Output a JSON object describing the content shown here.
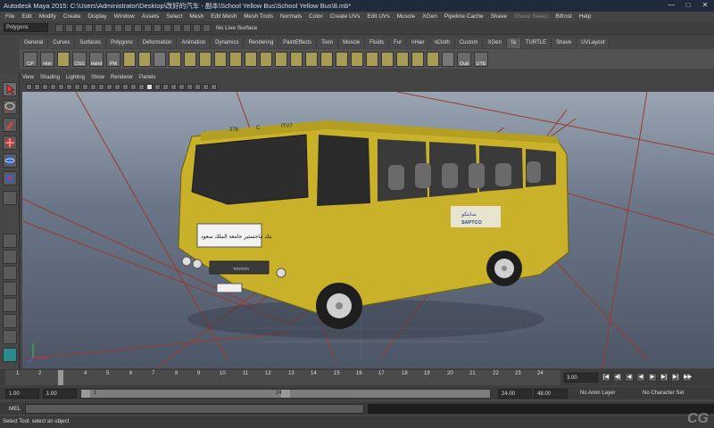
{
  "window": {
    "title": "Autodesk Maya 2015: C:\\Users\\Administrator\\Desktop\\改好的汽车 - 副本\\School Yellow Bus\\School Yellow Bus\\8.mb*",
    "minimize": "—",
    "maximize": "□",
    "close": "✕"
  },
  "menubar": [
    "File",
    "Edit",
    "Modify",
    "Create",
    "Display",
    "Window",
    "Assets",
    "Select",
    "Mesh",
    "Edit Mesh",
    "Mesh Tools",
    "Normals",
    "Color",
    "Create UVs",
    "Edit UVs",
    "Muscle",
    "XGen",
    "Pipeline Cache",
    "Shave",
    "Shave Select",
    "Bifrost",
    "Help"
  ],
  "statusline": {
    "mode": "Polygons",
    "live_surface": "No Live Surface"
  },
  "shelf_tabs": [
    "General",
    "Curves",
    "Surfaces",
    "Polygons",
    "Deformation",
    "Animation",
    "Dynamics",
    "Rendering",
    "PaintEffects",
    "Toon",
    "Muscle",
    "Fluids",
    "Fur",
    "nHair",
    "nCloth",
    "Custom",
    "XGen",
    "fa",
    "TURTLE",
    "Shave",
    "UVLayout"
  ],
  "shelf_tab_active": "fa",
  "shelf_labels": [
    "CP",
    "Hist",
    "OSS",
    "Hshd",
    "PM",
    "Outl",
    "UTE"
  ],
  "panel_menu": [
    "View",
    "Shading",
    "Lighting",
    "Show",
    "Renderer",
    "Panels"
  ],
  "bus": {
    "front_plate": "ITV7",
    "front_number": "276",
    "front_letter": "C",
    "windshield_text": "بنك ماجستير جامعة الملك سعود",
    "side_logo": "SAPTCO",
    "side_logo_arabic": "سابتكو",
    "grill_badge": "TOYOTA",
    "color": "#c9b12a"
  },
  "timeslider": {
    "ticks": [
      "1",
      "2",
      "3",
      "4",
      "5",
      "6",
      "7",
      "8",
      "9",
      "10",
      "11",
      "12",
      "13",
      "14",
      "15",
      "16",
      "17",
      "18",
      "19",
      "20",
      "21",
      "22",
      "23",
      "24"
    ],
    "current_frame": "3.00"
  },
  "playback": [
    "|◀",
    "◀|",
    "◀",
    "◀",
    "▶",
    "▶|",
    "▶|",
    "▶▶"
  ],
  "rangeslider": {
    "start": "1.00",
    "playback_start": "1.00",
    "range_left": "1",
    "range_right": "24",
    "playback_end": "24.00",
    "end": "48.00",
    "anim_layer": "No Anim Layer",
    "character_set": "No Character Set"
  },
  "cmdline": {
    "label": "MEL"
  },
  "helpline": "Select Tool: select an object",
  "watermark": "CG"
}
